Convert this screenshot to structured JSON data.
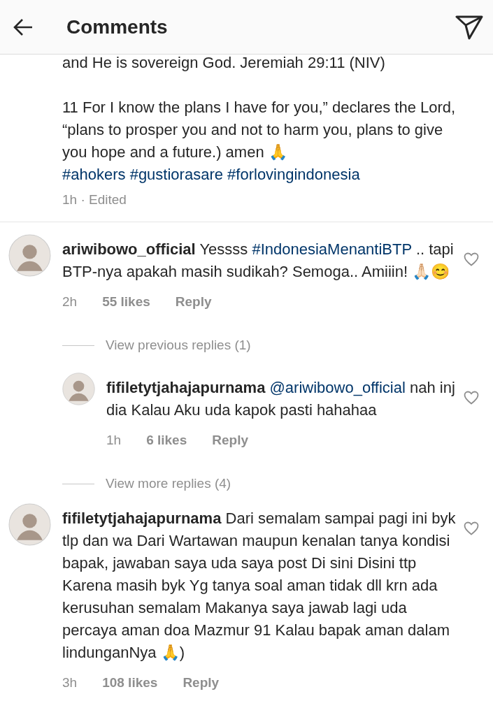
{
  "header": {
    "title": "Comments"
  },
  "caption": {
    "cut_line": "and He is sovereign God. Jeremiah 29:11 (NIV)",
    "text": "11 For I know the plans I have for you,” declares the Lord, “plans to prosper you and not to harm you, plans to give you hope and a future.) amen 🙏",
    "hashtags": [
      "#ahokers",
      "#gustiorasare",
      "#forlovingindonesia"
    ],
    "meta": "1h · Edited"
  },
  "comments": [
    {
      "kind": "comment",
      "username": "ariwibowo_official",
      "body": [
        {
          "kind": "text",
          "text": "Yessss"
        },
        {
          "kind": "tag",
          "text": "#IndonesiaMenantiBTP"
        },
        {
          "kind": "text",
          "text": ".. tapi BTP-nya apakah masih sudikah? Semoga.. Amiiin! 🙏🏻😊"
        }
      ],
      "time": "2h",
      "likes": "55 likes",
      "reply": "Reply",
      "liked": false
    },
    {
      "kind": "view_replies",
      "label": "View previous replies (1)"
    },
    {
      "kind": "reply",
      "username": "fifiletytjahajapurnama",
      "body": [
        {
          "kind": "tag",
          "text": "@ariwibowo_official"
        },
        {
          "kind": "text",
          "text": "nah inj dia Kalau Aku uda kapok pasti hahahaa"
        }
      ],
      "time": "1h",
      "likes": "6 likes",
      "reply": "Reply",
      "liked": false
    },
    {
      "kind": "view_replies",
      "label": "View more replies (4)"
    },
    {
      "kind": "comment",
      "username": "fifiletytjahajapurnama",
      "body": [
        {
          "kind": "text",
          "text": "Dari semalam sampai pagi ini byk tlp dan wa Dari Wartawan maupun kenalan tanya kondisi bapak, jawaban saya uda saya post Di sini Disini ttp Karena masih byk Yg tanya soal aman tidak dll krn ada kerusuhan semalam Makanya saya jawab lagi  uda percaya aman doa Mazmur 91 Kalau bapak aman dalam lindunganNya 🙏)"
        }
      ],
      "time": "3h",
      "likes": "108 likes",
      "reply": "Reply",
      "liked": false
    }
  ]
}
